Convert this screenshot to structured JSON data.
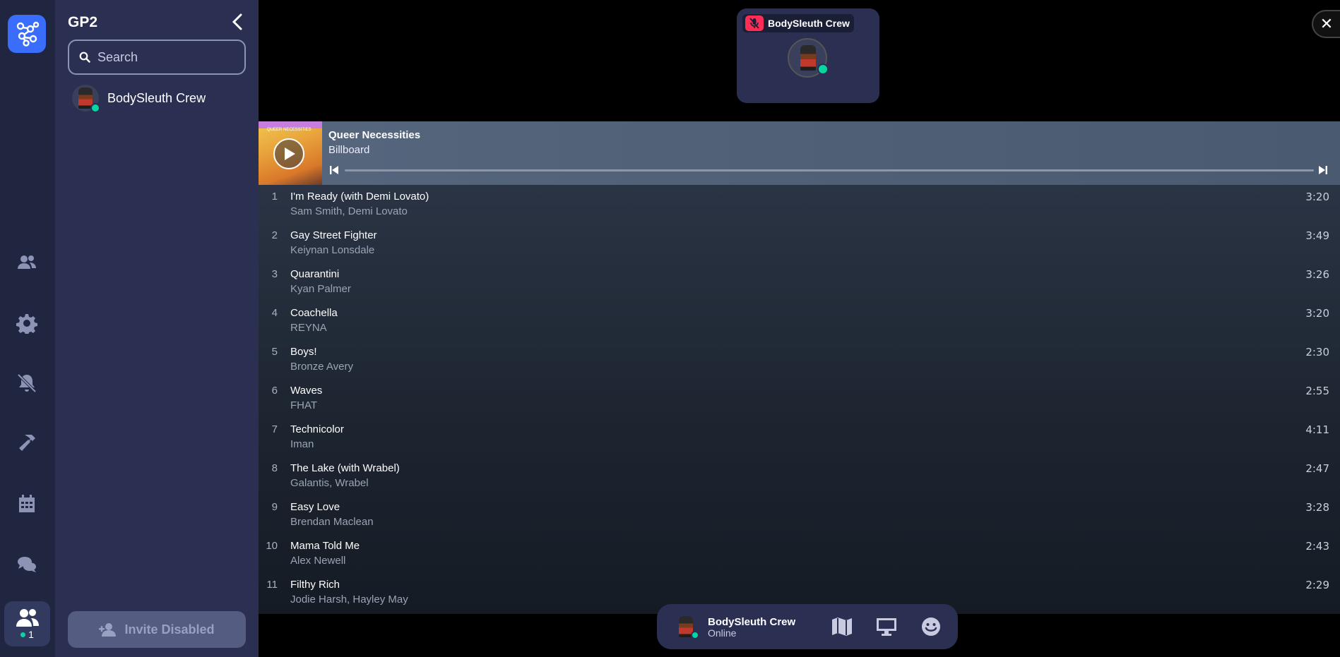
{
  "sidebar": {
    "space_name": "GP2",
    "search_placeholder": "Search",
    "members": [
      {
        "name": "BodySleuth Crew",
        "status": "online"
      }
    ],
    "invite_label": "Invite Disabled"
  },
  "rail": {
    "online_count": "1",
    "icons": [
      "people-icon",
      "gear-icon",
      "bell-off-icon",
      "hammer-icon",
      "calendar-icon",
      "chat-icon",
      "group-icon"
    ]
  },
  "video_tile": {
    "name": "BodySleuth Crew"
  },
  "player": {
    "title": "Queer Necessities",
    "artist": "Billboard",
    "album_banner": "QUEER NECESSITIES",
    "progress": 0.0
  },
  "tracks": [
    {
      "num": "1",
      "title": "I'm Ready (with Demi Lovato)",
      "artists": "Sam Smith, Demi Lovato",
      "duration": "3:20"
    },
    {
      "num": "2",
      "title": "Gay Street Fighter",
      "artists": "Keiynan Lonsdale",
      "duration": "3:49"
    },
    {
      "num": "3",
      "title": "Quarantini",
      "artists": "Kyan Palmer",
      "duration": "3:26"
    },
    {
      "num": "4",
      "title": "Coachella",
      "artists": "REYNA",
      "duration": "3:20"
    },
    {
      "num": "5",
      "title": "Boys!",
      "artists": "Bronze Avery",
      "duration": "2:30"
    },
    {
      "num": "6",
      "title": "Waves",
      "artists": "FHAT",
      "duration": "2:55"
    },
    {
      "num": "7",
      "title": "Technicolor",
      "artists": "Iman",
      "duration": "4:11"
    },
    {
      "num": "8",
      "title": "The Lake (with Wrabel)",
      "artists": "Galantis, Wrabel",
      "duration": "2:47"
    },
    {
      "num": "9",
      "title": "Easy Love",
      "artists": "Brendan Maclean",
      "duration": "3:28"
    },
    {
      "num": "10",
      "title": "Mama Told Me",
      "artists": "Alex Newell",
      "duration": "2:43"
    },
    {
      "num": "11",
      "title": "Filthy Rich",
      "artists": "Jodie Harsh, Hayley May",
      "duration": "2:29"
    }
  ],
  "bottom_bar": {
    "name": "BodySleuth Crew",
    "status": "Online"
  },
  "colors": {
    "rail_bg": "#202540",
    "sidebar_bg": "#2b3053",
    "accent": "#3a6dfc",
    "online": "#06d6a0",
    "mic_off": "#ff2d55"
  }
}
